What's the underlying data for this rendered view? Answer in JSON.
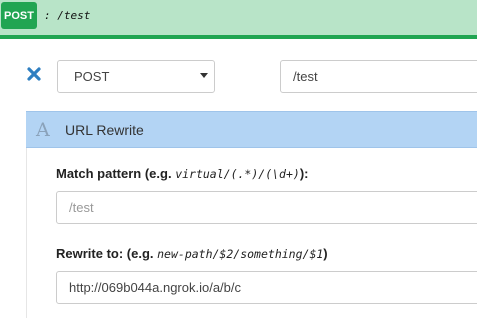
{
  "top_bar": {
    "method": "POST",
    "path": ": /test"
  },
  "rule": {
    "method_select": {
      "selected": "POST"
    },
    "path_input": {
      "value": "/test"
    }
  },
  "section": {
    "icon_letter": "A",
    "title": "URL Rewrite"
  },
  "match_pattern": {
    "label": "Match pattern",
    "example_prefix": " (e.g. ",
    "example_code": "virtual/(.*)/(\\d+)",
    "example_suffix": "):",
    "placeholder": "/test"
  },
  "rewrite_to": {
    "label": "Rewrite to:",
    "example_prefix": " (e.g. ",
    "example_code": "new-path/$2/something/$1",
    "example_suffix": ")",
    "value": "http://069b044a.ngrok.io/a/b/c"
  },
  "colors": {
    "post_green": "#21a552",
    "top_bar_bg": "#b8e4c8",
    "section_header_bg": "#b3d4f4",
    "remove_icon": "#2f7fc1"
  },
  "icons": {
    "remove": "close-icon",
    "select_caret": "caret-down-icon",
    "section": "font-letter-icon"
  }
}
